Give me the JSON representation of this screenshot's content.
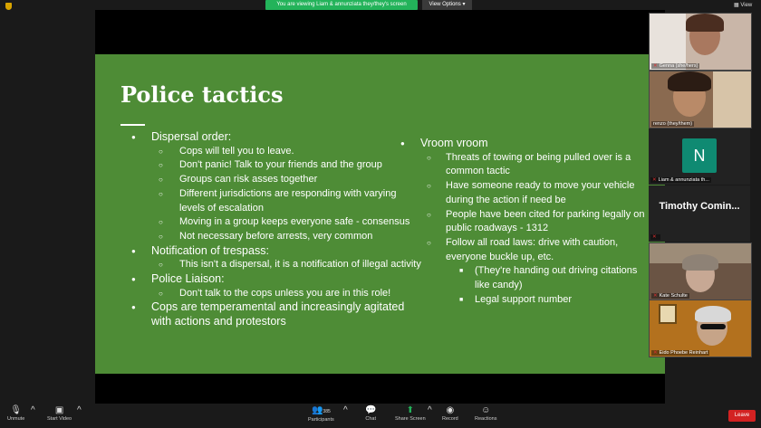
{
  "banner": {
    "viewing_text": "You are viewing Liam & annunziata they/they's screen",
    "view_options": "View Options ▾",
    "view_label": "View"
  },
  "slide": {
    "title": "Police tactics",
    "left": [
      {
        "level": 1,
        "text": "Dispersal order:"
      },
      {
        "level": 2,
        "text": "Cops will tell you to leave."
      },
      {
        "level": 2,
        "text": "Don't panic! Talk to your friends and the group"
      },
      {
        "level": 2,
        "text": "Groups can risk asses together"
      },
      {
        "level": 2,
        "text": "Different jurisdictions are responding with varying levels of escalation"
      },
      {
        "level": 2,
        "text": "Moving in a group keeps everyone safe - consensus"
      },
      {
        "level": 2,
        "text": "Not necessary before arrests, very common"
      },
      {
        "level": 1,
        "text": "Notification of trespass:"
      },
      {
        "level": 2,
        "text": "This isn't a dispersal, it is a notification of illegal activity"
      },
      {
        "level": 1,
        "text": "Police Liaison:"
      },
      {
        "level": 2,
        "text": "Don't talk to the cops unless you are in this role!"
      },
      {
        "level": 1,
        "text": "Cops are temperamental and increasingly agitated with actions and protestors"
      }
    ],
    "right": [
      {
        "level": 1,
        "text": "Vroom vroom"
      },
      {
        "level": 2,
        "text": "Threats of towing or being pulled over is a common tactic"
      },
      {
        "level": 2,
        "text": "Have someone ready to move your vehicle during the action if need be"
      },
      {
        "level": 2,
        "text": "People have been cited for parking legally on public roadways - 1312"
      },
      {
        "level": 2,
        "text": "Follow all road laws: drive with caution, everyone buckle up, etc."
      },
      {
        "level": 3,
        "text": "(They're handing out driving citations like candy)"
      },
      {
        "level": 3,
        "text": "Legal support number"
      }
    ]
  },
  "participants": {
    "p1": "Genna (she/hers)",
    "p2": "renzo (they/them)",
    "p3_initial": "N",
    "p3": "Liam & annunziata th...",
    "p4": "Timothy  Comin...",
    "p5": "Kate Schulte",
    "p6": "Eido Phoebe Reinhart"
  },
  "toolbar": {
    "unmute": "Unmute",
    "start_video": "Start Video",
    "participants": "Participants",
    "participants_count": "385",
    "chat": "Chat",
    "share_screen": "Share Screen",
    "record": "Record",
    "reactions": "Reactions",
    "leave": "Leave"
  }
}
